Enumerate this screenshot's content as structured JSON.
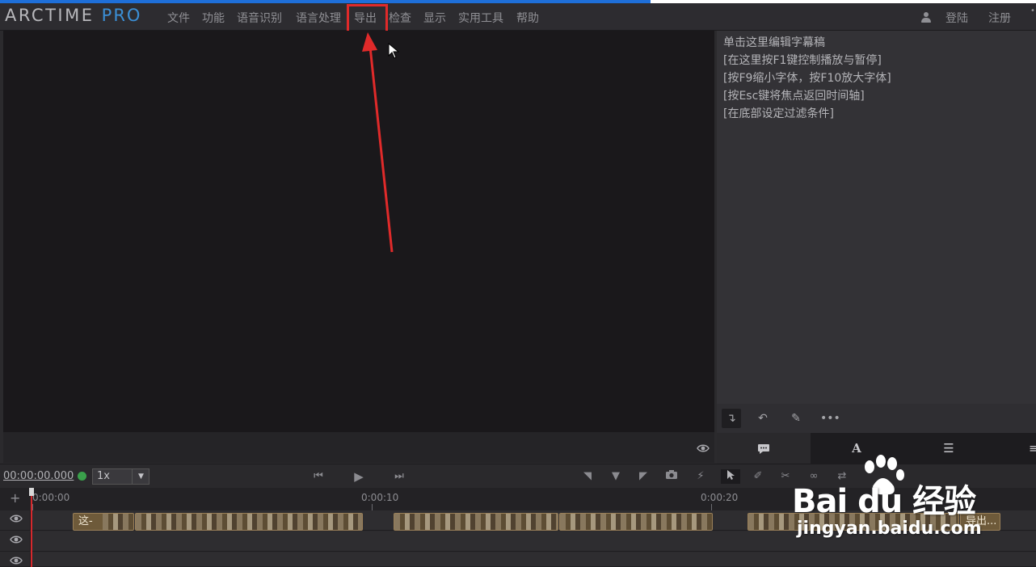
{
  "app": {
    "logo_main": "ARCTIME",
    "logo_pro": "PRO"
  },
  "menu": {
    "items": [
      "文件",
      "功能",
      "语音识别",
      "语言处理",
      "导出",
      "检查",
      "显示",
      "实用工具",
      "帮助"
    ],
    "login": "登陆",
    "register": "注册"
  },
  "panel": {
    "lines": [
      "单击这里编辑字幕稿",
      "[在这里按F1键控制播放与暂停]",
      "[按F9缩小字体，按F10放大字体]",
      "[按Esc键将焦点返回时间轴]",
      "[在底部设定过滤条件]"
    ]
  },
  "transport": {
    "timecode": "00:00:00.000",
    "speed": "1x"
  },
  "timeline": {
    "ticks": [
      "0:00:00",
      "0:00:10",
      "0:00:20"
    ],
    "clips": [
      {
        "text": "这-"
      },
      {
        "text": ""
      },
      {
        "text": ""
      },
      {
        "text": ""
      },
      {
        "text": ""
      },
      {
        "text": "导出..."
      }
    ]
  },
  "watermark": {
    "main": "Bai du 经验",
    "sub": "jingyan.baidu.com"
  },
  "colors": {
    "accent_blue": "#3b8fd6",
    "highlight_red": "#e02a2a",
    "clip": "#6e5a3a",
    "record_green": "#3aa04b"
  }
}
